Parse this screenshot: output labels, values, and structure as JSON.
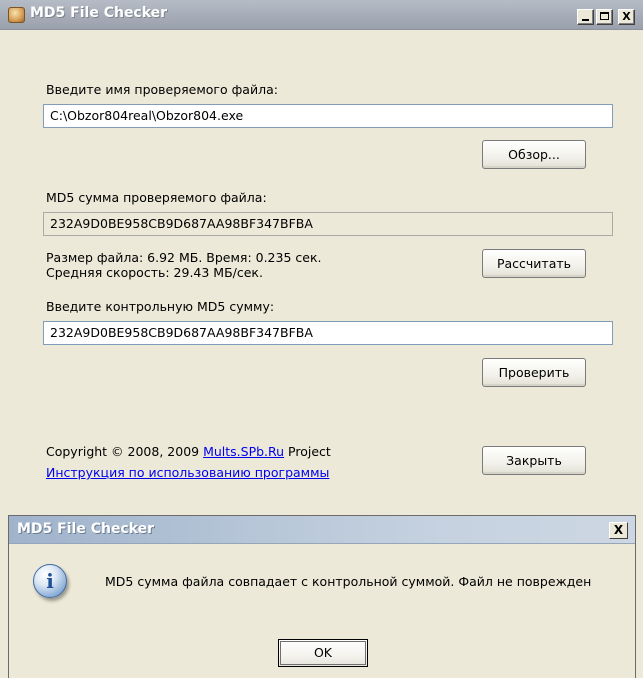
{
  "main_window": {
    "title": "MD5 File Checker",
    "file_label": "Введите имя проверяемого файла:",
    "file_path": "C:\\Obzor804real\\Obzor804.exe",
    "browse_button": "Обзор...",
    "md5_label": "MD5 сумма проверяемого файла:",
    "md5_value": "232A9D0BE958CB9D687AA98BF347BFBA",
    "size_time_text": "Размер файла: 6.92 МБ. Время: 0.235 сек.",
    "speed_text": "Средняя скорость: 29.43 МБ/сек.",
    "calculate_button": "Рассчитать",
    "control_label": "Введите контрольную MD5 сумму:",
    "control_value": "232A9D0BE958CB9D687AA98BF347BFBA",
    "verify_button": "Проверить",
    "copyright_prefix": "Copyright © 2008, 2009 ",
    "copyright_link": "Mults.SPb.Ru",
    "copyright_suffix": " Project",
    "instructions_link": "Инструкция по использованию программы",
    "close_button": "Закрыть",
    "caption_close": "X"
  },
  "message_box": {
    "title": "MD5 File Checker",
    "icon": "info-icon",
    "icon_glyph": "i",
    "message": "MD5 сумма файла совпадает с контрольной суммой. Файл не поврежден",
    "ok_button": "OK",
    "close_glyph": "X"
  }
}
